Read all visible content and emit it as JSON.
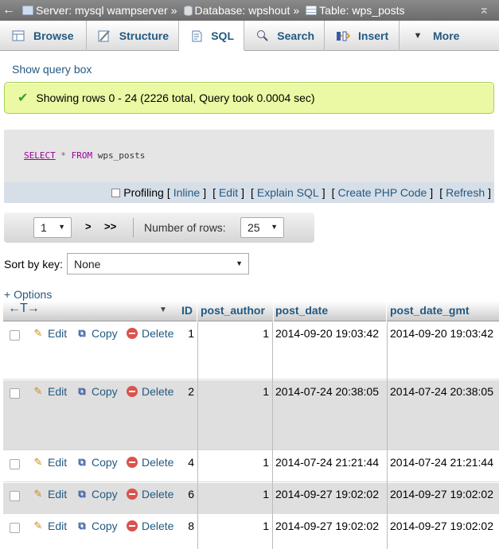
{
  "breadcrumb": {
    "server": "Server: mysql wampserver",
    "database": "Database: wpshout",
    "table": "Table: wps_posts",
    "separator": "»"
  },
  "tabs": [
    {
      "label": "Browse",
      "icon": "browse-icon"
    },
    {
      "label": "Structure",
      "icon": "structure-icon"
    },
    {
      "label": "SQL",
      "icon": "sql-icon",
      "active": true
    },
    {
      "label": "Search",
      "icon": "search-icon"
    },
    {
      "label": "Insert",
      "icon": "insert-icon"
    },
    {
      "label": "More",
      "icon": "chevron-down-icon"
    }
  ],
  "show_query_box": "Show query box",
  "message": "Showing rows 0 - 24 (2226 total, Query took 0.0004 sec)",
  "query": {
    "select": "SELECT",
    "star": "*",
    "from": "FROM",
    "table": "wps_posts"
  },
  "sql_links": {
    "profiling": "Profiling",
    "inline": "Inline",
    "edit": "Edit",
    "explain": "Explain SQL",
    "php": "Create PHP Code",
    "refresh": "Refresh",
    "open_bracket": "[",
    "close_bracket": "]"
  },
  "nav": {
    "page": "1",
    "next": ">",
    "last": ">>",
    "rows_label": "Number of rows:",
    "rows_value": "25"
  },
  "sort": {
    "label": "Sort by key:",
    "value": "None"
  },
  "options_link": "+ Options",
  "table": {
    "columns": [
      "ID",
      "post_author",
      "post_date",
      "post_date_gmt"
    ],
    "actions": {
      "edit": "Edit",
      "copy": "Copy",
      "delete": "Delete"
    },
    "rows": [
      {
        "id": "1",
        "author": "1",
        "date": "2014-09-20 19:03:42",
        "gmt": "2014-09-20 19:03:42"
      },
      {
        "id": "2",
        "author": "1",
        "date": "2014-07-24 20:38:05",
        "gmt": "2014-07-24 20:38:05"
      },
      {
        "id": "4",
        "author": "1",
        "date": "2014-07-24 21:21:44",
        "gmt": "2014-07-24 21:21:44"
      },
      {
        "id": "6",
        "author": "1",
        "date": "2014-09-27 19:02:02",
        "gmt": "2014-09-27 19:02:02"
      },
      {
        "id": "8",
        "author": "1",
        "date": "2014-09-27 19:02:02",
        "gmt": "2014-09-27 19:02:02"
      }
    ]
  }
}
